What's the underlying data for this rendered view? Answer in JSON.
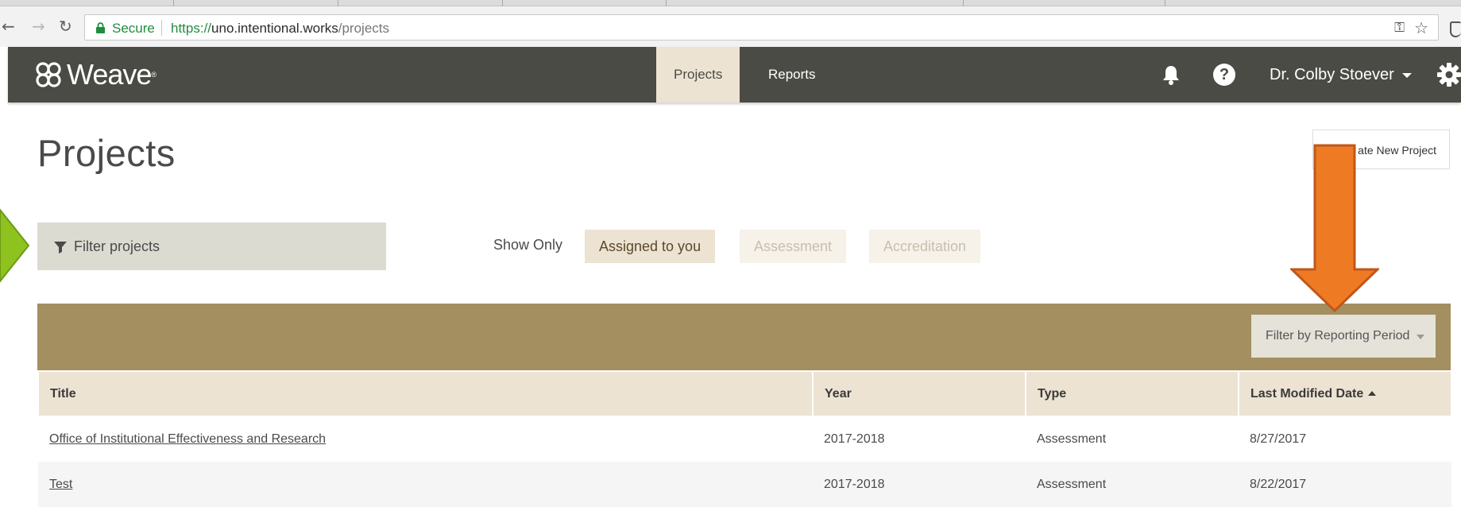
{
  "browser": {
    "secure_label": "Secure",
    "url_scheme": "https://",
    "url_host": "uno.intentional.works",
    "url_path": "/projects"
  },
  "navbar": {
    "logo_text": "Weave",
    "logo_tm": "®",
    "tabs": [
      {
        "label": "Projects",
        "active": true
      },
      {
        "label": "Reports",
        "active": false
      }
    ],
    "help_glyph": "?",
    "user_name": "Dr. Colby Stoever"
  },
  "page": {
    "title": "Projects",
    "create_button": "ate New Project"
  },
  "filter": {
    "placeholder": "Filter projects",
    "show_only_label": "Show Only",
    "pills": [
      {
        "label": "Assigned to you",
        "active": true
      },
      {
        "label": "Assessment",
        "active": false
      },
      {
        "label": "Accreditation",
        "active": false
      }
    ]
  },
  "table": {
    "period_filter_label": "Filter by Reporting Period",
    "columns": [
      "Title",
      "Year",
      "Type",
      "Last Modified Date"
    ],
    "rows": [
      {
        "title": "Office of Institutional Effectiveness and Research",
        "year": "2017-2018",
        "type": "Assessment",
        "modified": "8/27/2017"
      },
      {
        "title": "Test",
        "year": "2017-2018",
        "type": "Assessment",
        "modified": "8/22/2017"
      }
    ]
  },
  "colors": {
    "navbar": "#4b4b45",
    "accent_tan": "#a48f60",
    "active_tab": "#ede3d3",
    "annotation_green": "#8dc21f",
    "annotation_orange": "#ee7b24"
  },
  "icons": [
    "lock-icon",
    "key-icon",
    "star-icon",
    "weave-logo-icon",
    "bell-icon",
    "help-icon",
    "gear-icon",
    "funnel-icon",
    "sort-asc-icon",
    "dropdown-caret-icon"
  ]
}
